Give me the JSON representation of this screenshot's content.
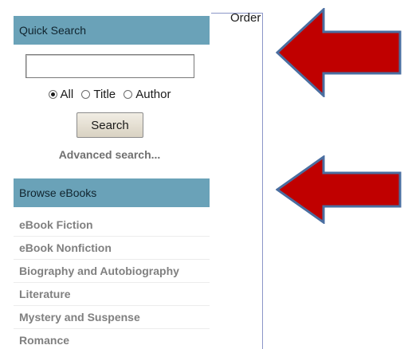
{
  "quick_search": {
    "title": "Quick Search",
    "input_value": "",
    "options": [
      {
        "label": "All",
        "checked": true
      },
      {
        "label": "Title",
        "checked": false
      },
      {
        "label": "Author",
        "checked": false
      }
    ],
    "search_label": "Search",
    "advanced_label": "Advanced search..."
  },
  "browse": {
    "title": "Browse eBooks",
    "items": [
      "eBook Fiction",
      "eBook Nonfiction",
      "Biography and Autobiography",
      "Literature",
      "Mystery and Suspense",
      "Romance"
    ]
  },
  "main": {
    "partial_text": "Order"
  },
  "colors": {
    "header_bg": "#6aa2b8",
    "arrow_fill": "#c00000",
    "arrow_stroke": "#4a6ea0"
  }
}
